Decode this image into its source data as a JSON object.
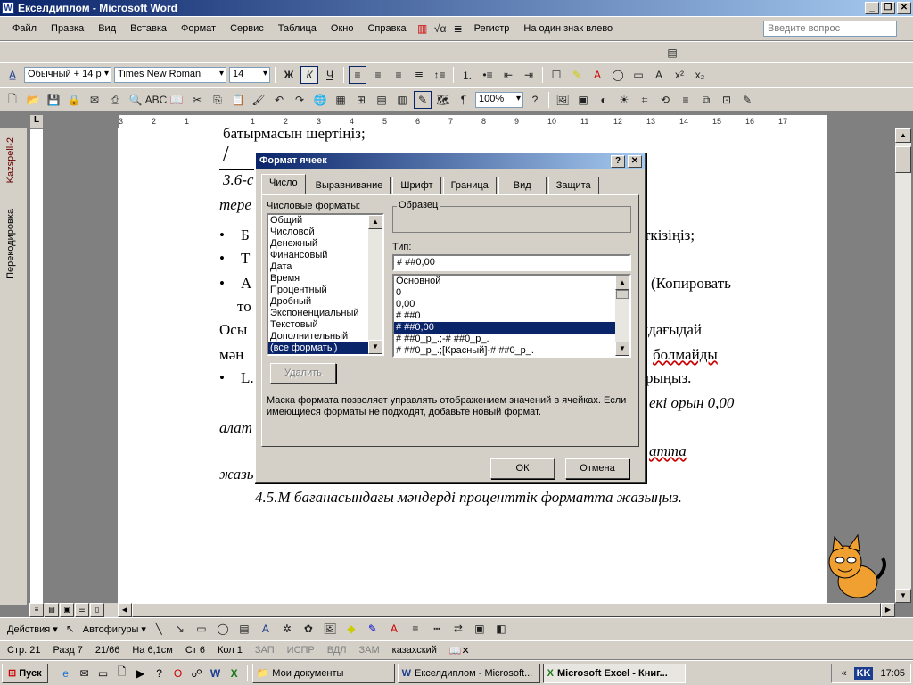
{
  "window": {
    "title": "Екселдиплом - Microsoft Word",
    "app_icon": "W"
  },
  "menu": {
    "items": [
      "Файл",
      "Правка",
      "Вид",
      "Вставка",
      "Формат",
      "Сервис",
      "Таблица",
      "Окно",
      "Справка"
    ],
    "extra1": "Регистр",
    "extra2": "На один знак влево",
    "question_placeholder": "Введите вопрос"
  },
  "format_bar": {
    "style": "Обычный + 14 р",
    "font": "Times New Roman",
    "size": "14",
    "bold": "Ж",
    "italic": "К",
    "underline": "Ч"
  },
  "standard_bar": {
    "zoom": "100%"
  },
  "ruler": {
    "ticks": [
      "3",
      "2",
      "1",
      "",
      "1",
      "2",
      "3",
      "4",
      "5",
      "6",
      "7",
      "8",
      "9",
      "10",
      "11",
      "12",
      "13",
      "14",
      "15",
      "16",
      "17"
    ]
  },
  "sidebar": {
    "label1": "Kazspell-2",
    "label2": "Перекодировка"
  },
  "document": {
    "lines": [
      "батырмасын шертіңіз;",
      "3.6-с",
      "тере",
      "Б",
      "ткізіңіз;",
      "Т",
      "А",
      "(Копировать",
      "то",
      "Осы",
      "ндағыдай",
      "мән",
      "болмайды",
      "L.",
      "рыңыз.",
      "екі орын 0,00",
      "алат",
      "атта",
      "жазы",
      "4.5.М бағанасындағы мәндерді проценттік форматта жазыңыз."
    ]
  },
  "dialog": {
    "title": "Формат ячеек",
    "help_btn": "?",
    "close_btn": "✕",
    "tabs": [
      "Число",
      "Выравнивание",
      "Шрифт",
      "Граница",
      "Вид",
      "Защита"
    ],
    "formats_label": "Числовые форматы:",
    "formats": [
      "Общий",
      "Числовой",
      "Денежный",
      "Финансовый",
      "Дата",
      "Время",
      "Процентный",
      "Дробный",
      "Экспоненциальный",
      "Текстовый",
      "Дополнительный",
      "(все форматы)"
    ],
    "selected_format": "(все форматы)",
    "sample_label": "Образец",
    "type_label": "Тип:",
    "type_value": "# ##0,00",
    "types": [
      "Основной",
      "0",
      "0,00",
      "# ##0",
      "# ##0,00",
      "# ##0_р_.;-# ##0_р_.",
      "# ##0_р_.;[Красный]-# ##0_р_."
    ],
    "selected_type": "# ##0,00",
    "delete_btn": "Удалить",
    "hint": "Маска формата позволяет управлять отображением значений в ячейках. Если имеющиеся форматы не подходят, добавьте новый формат.",
    "ok": "ОК",
    "cancel": "Отмена"
  },
  "drawing_bar": {
    "actions": "Действия ▾",
    "autoshapes": "Автофигуры ▾"
  },
  "status": {
    "page": "Стр. 21",
    "section": "Разд 7",
    "pages": "21/66",
    "at": "На 6,1см",
    "line": "Ст 6",
    "col": "Кол 1",
    "rec": "ЗАП",
    "trk": "ИСПР",
    "ext": "ВДЛ",
    "ovr": "ЗАМ",
    "lang": "казахский"
  },
  "taskbar": {
    "start": "Пуск",
    "tasks": [
      "Мои документы",
      "Екселдиплом - Microsoft...",
      "Microsoft Excel - Книг..."
    ],
    "lang": "KK",
    "time": "17:05",
    "chevron": "«"
  },
  "colors": {
    "title_start": "#0a246a",
    "title_end": "#a6caf0",
    "face": "#d4d0c8",
    "selection": "#0a246a"
  }
}
